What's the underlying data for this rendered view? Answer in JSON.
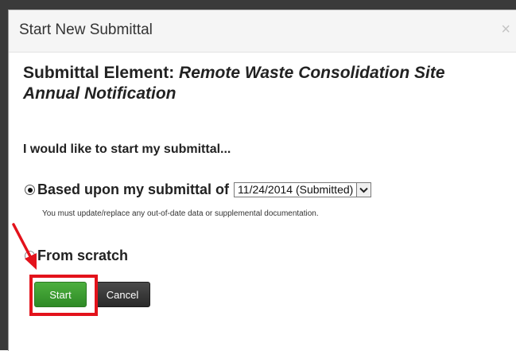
{
  "dialog": {
    "title": "Start New Submittal",
    "close_glyph": "×"
  },
  "element": {
    "prefix": "Submittal Element: ",
    "name": "Remote Waste Consolidation Site Annual Notification"
  },
  "prompt": "I would like to start my submittal...",
  "options": {
    "based_upon": {
      "label": "Based upon my submittal of",
      "checked": true,
      "select_value": "11/24/2014 (Submitted)",
      "note": "You must update/replace any out-of-date data or supplemental documentation."
    },
    "from_scratch": {
      "label": "From scratch",
      "checked": false
    }
  },
  "buttons": {
    "start": "Start",
    "cancel": "Cancel"
  },
  "colors": {
    "start_button": "#3a9a30",
    "cancel_button": "#333333",
    "annotation_red": "#e3121b"
  },
  "icons": {
    "close": "close-icon",
    "dropdown": "chevron-down-icon"
  }
}
